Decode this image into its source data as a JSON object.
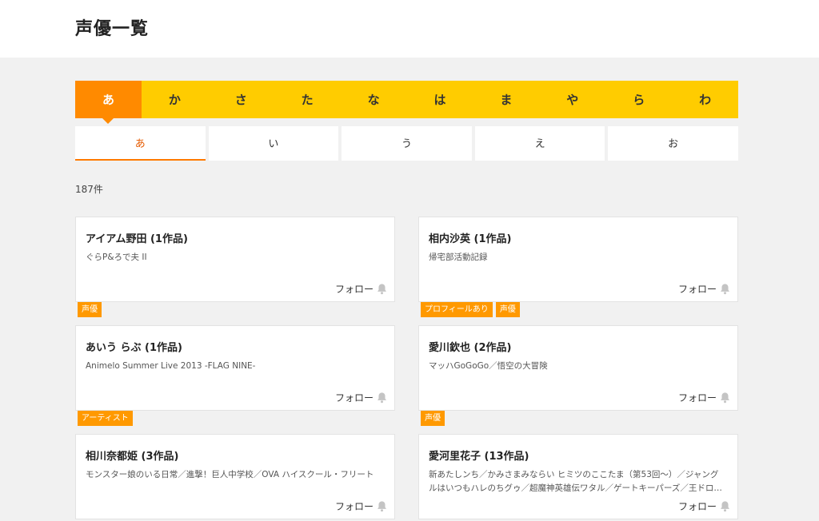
{
  "page": {
    "title": "声優一覧"
  },
  "kana_tabs": [
    "あ",
    "か",
    "さ",
    "た",
    "な",
    "は",
    "ま",
    "や",
    "ら",
    "わ"
  ],
  "sub_tabs": [
    "あ",
    "い",
    "う",
    "え",
    "お"
  ],
  "count_label": "187件",
  "follow_label": "フォロー",
  "colors": {
    "accent": "#ff8a00",
    "bar": "#ffcc00",
    "tag": "#ff9900",
    "active_text": "#e55a00"
  },
  "cards": [
    {
      "name": "アイアム野田 (1作品)",
      "works": "ぐらP&ろで夫 II",
      "tags": [
        "声優"
      ]
    },
    {
      "name": "相内沙英 (1作品)",
      "works": "帰宅部活動記録",
      "tags": [
        "プロフィールあり",
        "声優"
      ]
    },
    {
      "name": "あいう らぶ (1作品)",
      "works": "Animelo Summer Live 2013 -FLAG NINE-",
      "tags": [
        "アーティスト"
      ]
    },
    {
      "name": "愛川欽也 (2作品)",
      "works": "マッハGoGoGo／悟空の大冒険",
      "tags": [
        "声優"
      ]
    },
    {
      "name": "相川奈都姫 (3作品)",
      "works": "モンスター娘のいる日常／進撃！巨人中学校／OVA ハイスクール・フリート",
      "tags": []
    },
    {
      "name": "愛河里花子 (13作品)",
      "works": "新あたしンち／かみさまみならい ヒミツのここたま（第53回～）／ジャングルはいつもハレのちグゥ／超魔神英雄伝ワタル／ゲートキーパーズ／王ドロ…",
      "tags": []
    }
  ]
}
